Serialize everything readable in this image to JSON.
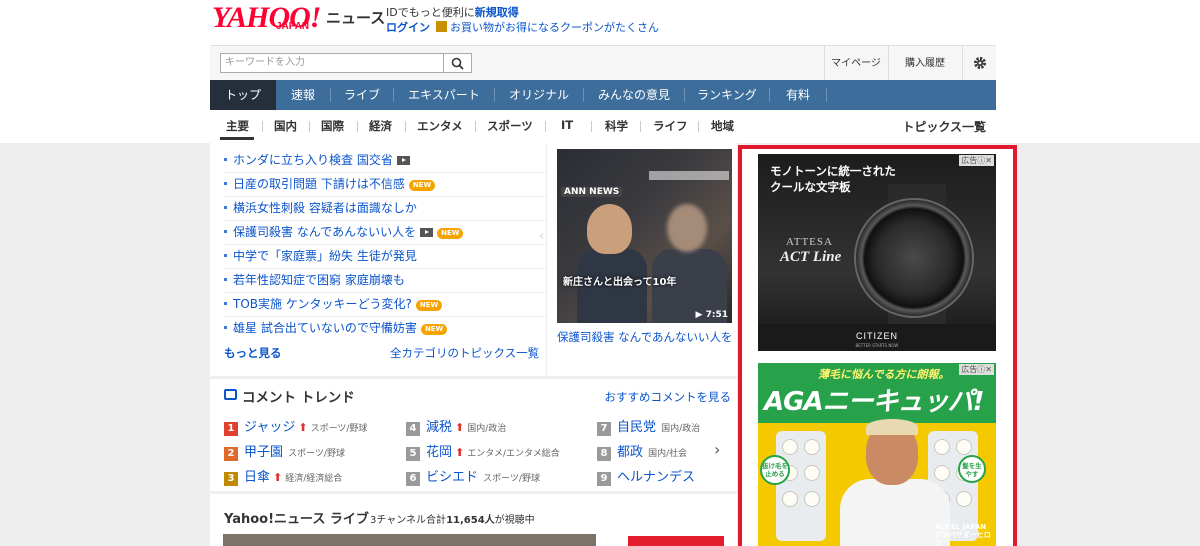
{
  "header": {
    "logo_main": "YAHOO!",
    "logo_sub": "JAPAN",
    "service_name": "ニュース",
    "promo_text": "IDでもっと便利に",
    "promo_link": "新規取得",
    "login_label": "ログイン",
    "coupon_text": "お買い物がお得になるクーポンがたくさん"
  },
  "search": {
    "placeholder": "キーワードを入力",
    "mypage_label": "マイページ",
    "history_label": "購入履歴"
  },
  "nav": {
    "tabs": [
      "トップ",
      "速報",
      "ライブ",
      "エキスパート",
      "オリジナル",
      "みんなの意見",
      "ランキング",
      "有料"
    ]
  },
  "subnav": {
    "items": [
      "主要",
      "国内",
      "国際",
      "経済",
      "エンタメ",
      "スポーツ",
      "IT",
      "科学",
      "ライフ",
      "地域"
    ],
    "topics_all": "トピックス一覧"
  },
  "topics": {
    "items": [
      {
        "title": "ホンダに立ち入り検査 国交省",
        "video": true,
        "new": false
      },
      {
        "title": "日産の取引問題 下請けは不信感",
        "video": false,
        "new": true
      },
      {
        "title": "横浜女性刺殺 容疑者は面識なしか",
        "video": false,
        "new": false
      },
      {
        "title": "保護司殺害 なんであんないい人を",
        "video": true,
        "new": true
      },
      {
        "title": "中学で「家庭票」紛失 生徒が発見",
        "video": false,
        "new": false
      },
      {
        "title": "若年性認知症で困窮 家庭崩壊も",
        "video": false,
        "new": false
      },
      {
        "title": "TOB実施 ケンタッキーどう変化?",
        "video": false,
        "new": true
      },
      {
        "title": "雄星 試合出ていないので守備妨害",
        "video": false,
        "new": true
      }
    ],
    "new_badge": "NEW",
    "more_label": "もっと見る",
    "all_categories_label": "全カテゴリのトピックス一覧"
  },
  "video": {
    "network": "ANN NEWS",
    "caption": "新庄さんと出会って10年",
    "duration": "▶ 7:51",
    "title": "保護司殺害 なんであんないい人を"
  },
  "comment_trend": {
    "title": "コメント トレンド",
    "more_label": "おすすめコメントを見る",
    "ranks": [
      {
        "num": "1",
        "word": "ジャッジ",
        "up": true,
        "category": "スポーツ/野球",
        "color": "#e0412f"
      },
      {
        "num": "2",
        "word": "甲子園",
        "up": false,
        "category": "スポーツ/野球",
        "color": "#e06a2a"
      },
      {
        "num": "3",
        "word": "日傘",
        "up": true,
        "category": "経済/経済総合",
        "color": "#c08a00"
      },
      {
        "num": "4",
        "word": "減税",
        "up": true,
        "category": "国内/政治",
        "color": "#9a9a9a"
      },
      {
        "num": "5",
        "word": "花岡",
        "up": true,
        "category": "エンタメ/エンタメ総合",
        "color": "#9a9a9a"
      },
      {
        "num": "6",
        "word": "ビシエド",
        "up": false,
        "category": "スポーツ/野球",
        "color": "#9a9a9a"
      },
      {
        "num": "7",
        "word": "自民党",
        "up": false,
        "category": "国内/政治",
        "color": "#9a9a9a"
      },
      {
        "num": "8",
        "word": "都政",
        "up": false,
        "category": "国内/社会",
        "color": "#9a9a9a"
      },
      {
        "num": "9",
        "word": "ヘルナンデス",
        "up": false,
        "category": "",
        "color": "#9a9a9a"
      }
    ]
  },
  "live": {
    "title": "Yahoo!ニュース ライブ",
    "count_prefix": "3チャンネル合計",
    "count_value": "11,654人",
    "count_suffix": "が視聴中"
  },
  "ads": {
    "tag": "広告ⓘ✕",
    "ad1_headline_line1": "モノトーンに統一された",
    "ad1_headline_line2": "クールな文字板",
    "ad1_product1": "ATTESA",
    "ad1_product2": "ACT Line",
    "ad1_brand": "CITIZEN",
    "ad1_brand_sub": "BETTER STARTS NOW",
    "ad2_headline": "薄毛に悩んでる方に朗報。",
    "ad2_big": "AGAニーキュッパ!",
    "ad2_badge1": "抜け毛を止める",
    "ad2_badge2": "髪を生やす",
    "ad2_brand_line1": "ACCEL JAPAN",
    "ad2_brand_line2": "アンバサダーヒロミ"
  },
  "colors": {
    "brand_red": "#ff0033",
    "nav_bg": "#3d6d9a",
    "nav_active": "#252e3b",
    "link_blue": "#0b55cc",
    "new_badge": "#f5a300",
    "ad_frame": "#e3172d"
  },
  "icons": {
    "search": "search-icon",
    "settings": "gear-icon",
    "video": "video-icon",
    "comment": "comment-icon",
    "rank_up": "arrow-up-icon",
    "next": "chevron-right-icon"
  }
}
